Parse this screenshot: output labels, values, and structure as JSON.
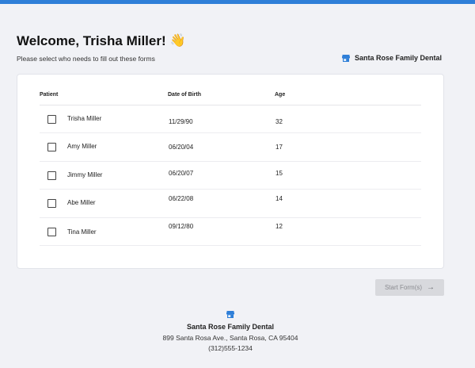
{
  "header": {
    "title": "Welcome, Trisha Miller!",
    "title_emoji": "👋",
    "subtitle": "Please select who needs to fill out these forms",
    "practice_name": "Santa Rose Family Dental",
    "practice_icon": "store-icon",
    "accent_color": "#2f7fd8"
  },
  "table": {
    "columns": {
      "patient": "Patient",
      "dob": "Date of Birth",
      "age": "Age"
    },
    "rows": [
      {
        "name": "Trisha Miller",
        "dob": "11/29/90",
        "age": "32",
        "checked": false
      },
      {
        "name": "Amy Miller",
        "dob": "06/20/04",
        "age": "17",
        "checked": false
      },
      {
        "name": "Jimmy Miller",
        "dob": "06/20/07",
        "age": "15",
        "checked": false
      },
      {
        "name": "Abe Miller",
        "dob": "06/22/08",
        "age": "14",
        "checked": false
      },
      {
        "name": "Tina Miller",
        "dob": "09/12/80",
        "age": "12",
        "checked": false
      }
    ]
  },
  "actions": {
    "start_label": "Start Form(s)",
    "start_icon": "arrow-right-icon",
    "start_disabled": true
  },
  "footer": {
    "icon": "store-icon",
    "name": "Santa Rose Family Dental",
    "address": "899 Santa Rosa Ave., Santa Rosa, CA 95404",
    "phone": "(312)555-1234"
  }
}
